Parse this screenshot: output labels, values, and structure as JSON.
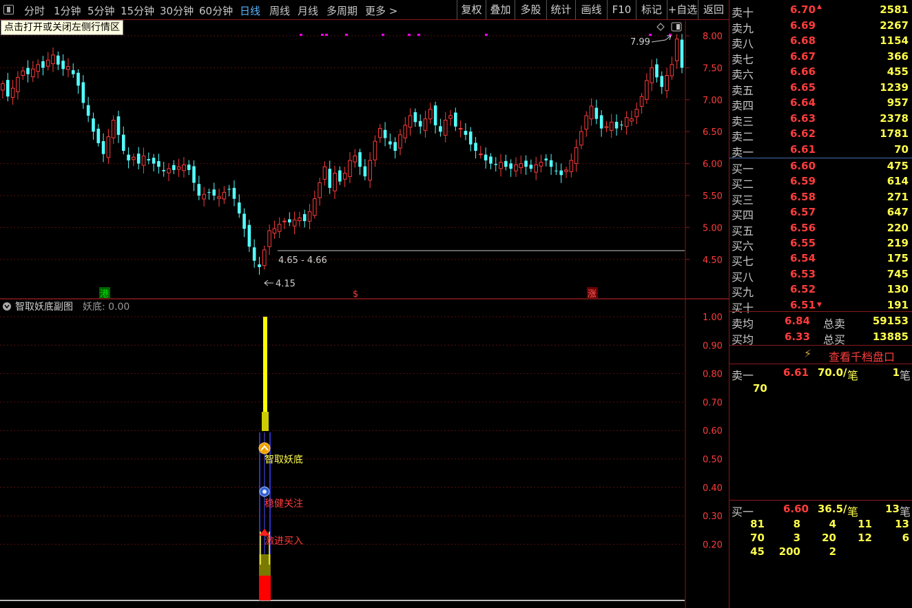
{
  "toolbar": {
    "periods": [
      "分时",
      "1分钟",
      "5分钟",
      "15分钟",
      "30分钟",
      "60分钟",
      "日线",
      "周线",
      "月线",
      "多周期",
      "更多 >"
    ],
    "active_period": "日线",
    "buttons": [
      "复权",
      "叠加",
      "多股",
      "统计",
      "画线",
      "F10",
      "标记",
      "+自选",
      "返回"
    ]
  },
  "tooltip": "点击打开或关闭左侧行情区",
  "kline": {
    "y_labels": [
      "8.00",
      "7.50",
      "7.00",
      "6.50",
      "6.00",
      "5.50",
      "5.00",
      "4.50"
    ],
    "high_label": "7.99",
    "low_label": "4.15",
    "range_label": "4.65 - 4.66",
    "markers": [
      {
        "text": "港",
        "color": "#00c000"
      },
      {
        "text": "$",
        "color": "#ff3c3c"
      },
      {
        "text": "涨",
        "color": "#ff3c3c"
      }
    ]
  },
  "indicator": {
    "title": "智取妖底副图",
    "value_label": "妖底: 0.00",
    "y_labels": [
      "1.00",
      "0.90",
      "0.80",
      "0.70",
      "0.60",
      "0.50",
      "0.40",
      "0.30",
      "0.20"
    ],
    "signals": [
      {
        "text": "智取妖底",
        "color": "#ffff4c"
      },
      {
        "text": "稳健关注",
        "color": "#ff3c3c"
      },
      {
        "text": "激进买入",
        "color": "#ff3c3c"
      }
    ]
  },
  "order_book": {
    "asks": [
      {
        "label": "卖十",
        "price": "6.70",
        "volume": "2581"
      },
      {
        "label": "卖九",
        "price": "6.69",
        "volume": "2267"
      },
      {
        "label": "卖八",
        "price": "6.68",
        "volume": "1154"
      },
      {
        "label": "卖七",
        "price": "6.67",
        "volume": "366"
      },
      {
        "label": "卖六",
        "price": "6.66",
        "volume": "455"
      },
      {
        "label": "卖五",
        "price": "6.65",
        "volume": "1239"
      },
      {
        "label": "卖四",
        "price": "6.64",
        "volume": "957"
      },
      {
        "label": "卖三",
        "price": "6.63",
        "volume": "2378"
      },
      {
        "label": "卖二",
        "price": "6.62",
        "volume": "1781"
      },
      {
        "label": "卖一",
        "price": "6.61",
        "volume": "70"
      }
    ],
    "bids": [
      {
        "label": "买一",
        "price": "6.60",
        "volume": "475"
      },
      {
        "label": "买二",
        "price": "6.59",
        "volume": "614"
      },
      {
        "label": "买三",
        "price": "6.58",
        "volume": "271"
      },
      {
        "label": "买四",
        "price": "6.57",
        "volume": "647"
      },
      {
        "label": "买五",
        "price": "6.56",
        "volume": "220"
      },
      {
        "label": "买六",
        "price": "6.55",
        "volume": "219"
      },
      {
        "label": "买七",
        "price": "6.54",
        "volume": "175"
      },
      {
        "label": "买八",
        "price": "6.53",
        "volume": "745"
      },
      {
        "label": "买九",
        "price": "6.52",
        "volume": "130"
      },
      {
        "label": "买十",
        "price": "6.51",
        "volume": "191"
      }
    ],
    "sell_avg": {
      "label": "卖均",
      "price": "6.84",
      "total_label": "总卖",
      "total": "59153"
    },
    "buy_avg": {
      "label": "买均",
      "price": "6.33",
      "total_label": "总买",
      "total": "13885"
    },
    "deep_link": "查看千档盘口",
    "ask1_detail": {
      "label": "卖一",
      "price": "6.61",
      "per": "70.0/",
      "per_unit": "笔",
      "count": "1",
      "count_unit": "笔",
      "orders": [
        "70"
      ]
    },
    "bid1_detail": {
      "label": "买一",
      "price": "6.60",
      "per": "36.5/",
      "per_unit": "笔",
      "count": "13",
      "count_unit": "笔",
      "orders": [
        [
          "81",
          "8",
          "4",
          "11",
          "13"
        ],
        [
          "70",
          "3",
          "20",
          "12",
          "6"
        ],
        [
          "45",
          "200",
          "2",
          "",
          ""
        ]
      ]
    }
  },
  "colors": {
    "up": "#ff3c3c",
    "down": "#54ffff",
    "text_yellow": "#ffff4c",
    "active": "#5ab4ff",
    "border": "#8b1a1a"
  }
}
